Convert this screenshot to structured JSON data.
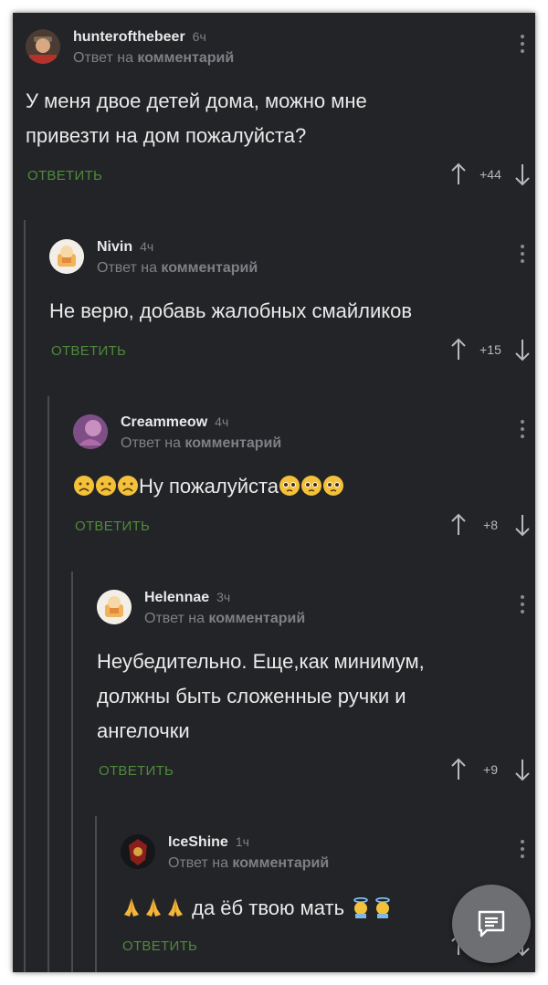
{
  "labels": {
    "reply_to": "Ответ на",
    "comment_word": "комментарий",
    "reply_button": "ОТВЕТИТЬ"
  },
  "comments": [
    {
      "username": "hunterofthebeer",
      "time": "6ч",
      "text": "У меня двое детей дома, можно мне привезти на дом пожалуйста?",
      "score": "+44",
      "avatar_icon": "bearded-man-avatar"
    },
    {
      "username": "Nivin",
      "time": "4ч",
      "text": "Не верю, добавь жалобных смайликов",
      "score": "+15",
      "avatar_icon": "cartoon-avatar"
    },
    {
      "username": "Creammeow",
      "time": "4ч",
      "text": "Ну пожалуйста",
      "score": "+8",
      "avatar_icon": "purple-photo-avatar"
    },
    {
      "username": "Helennae",
      "time": "3ч",
      "text": "Неубедительно. Еще,как минимум, должны быть сложенные ручки и ангелочки",
      "score": "+9",
      "avatar_icon": "cartoon-avatar"
    },
    {
      "username": "IceShine",
      "time": "1ч",
      "text": "да ёб твою мать",
      "score": "",
      "avatar_icon": "dark-emblem-avatar"
    }
  ],
  "emoji_names": {
    "sad": "disappointed-face-emoji",
    "pleading": "pleading-face-emoji",
    "pray": "folded-hands-emoji",
    "angel": "angel-emoji"
  },
  "colors": {
    "background": "#232427",
    "accent": "#4f8a3b",
    "text": "#eaeaea",
    "muted": "#7e8085"
  }
}
